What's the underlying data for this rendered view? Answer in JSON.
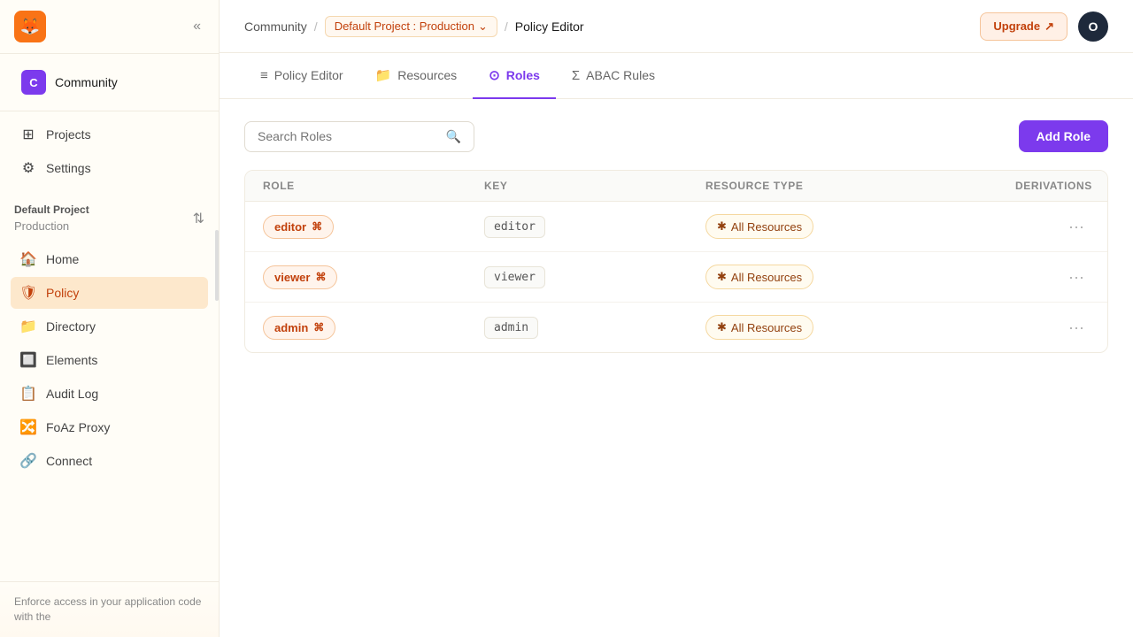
{
  "app": {
    "logo_symbol": "🦊",
    "logo_alt": "Permit.io"
  },
  "sidebar": {
    "collapse_icon": "«",
    "org": {
      "avatar": "C",
      "name": "Community"
    },
    "nav_items": [
      {
        "id": "projects",
        "icon": "⊞",
        "label": "Projects"
      },
      {
        "id": "settings",
        "icon": "⚙",
        "label": "Settings"
      }
    ],
    "project": {
      "label": "Default Project",
      "env": "Production"
    },
    "project_nav": [
      {
        "id": "home",
        "icon": "🏠",
        "label": "Home"
      },
      {
        "id": "policy",
        "icon": "🛡",
        "label": "Policy",
        "active": true
      },
      {
        "id": "directory",
        "icon": "📁",
        "label": "Directory"
      },
      {
        "id": "elements",
        "icon": "🔲",
        "label": "Elements"
      },
      {
        "id": "audit-log",
        "icon": "📋",
        "label": "Audit Log"
      },
      {
        "id": "foaz-proxy",
        "icon": "🔀",
        "label": "FoAz Proxy"
      },
      {
        "id": "connect",
        "icon": "🔗",
        "label": "Connect"
      }
    ],
    "bottom_text": "Enforce access in your application code with the"
  },
  "topbar": {
    "breadcrumb": {
      "org": "Community",
      "project_env": "Default Project : Production",
      "current": "Policy Editor"
    },
    "upgrade_label": "Upgrade",
    "upgrade_icon": "↗",
    "user_avatar": "O"
  },
  "tabs": [
    {
      "id": "policy-editor",
      "icon": "≡",
      "label": "Policy Editor"
    },
    {
      "id": "resources",
      "icon": "📁",
      "label": "Resources"
    },
    {
      "id": "roles",
      "icon": "⊙",
      "label": "Roles",
      "active": true
    },
    {
      "id": "abac-rules",
      "icon": "Σ",
      "label": "ABAC Rules"
    }
  ],
  "roles": {
    "search_placeholder": "Search Roles",
    "add_role_label": "Add Role",
    "table_headers": [
      "ROLE",
      "KEY",
      "RESOURCE TYPE",
      "DERIVATIONS"
    ],
    "rows": [
      {
        "role": "editor",
        "role_icon": "⌘",
        "key": "editor",
        "resource_type": "All Resources",
        "resource_icon": "✱",
        "derivations": ""
      },
      {
        "role": "viewer",
        "role_icon": "⌘",
        "key": "viewer",
        "resource_type": "All Resources",
        "resource_icon": "✱",
        "derivations": ""
      },
      {
        "role": "admin",
        "role_icon": "⌘",
        "key": "admin",
        "resource_type": "All Resources",
        "resource_icon": "✱",
        "derivations": ""
      }
    ]
  }
}
